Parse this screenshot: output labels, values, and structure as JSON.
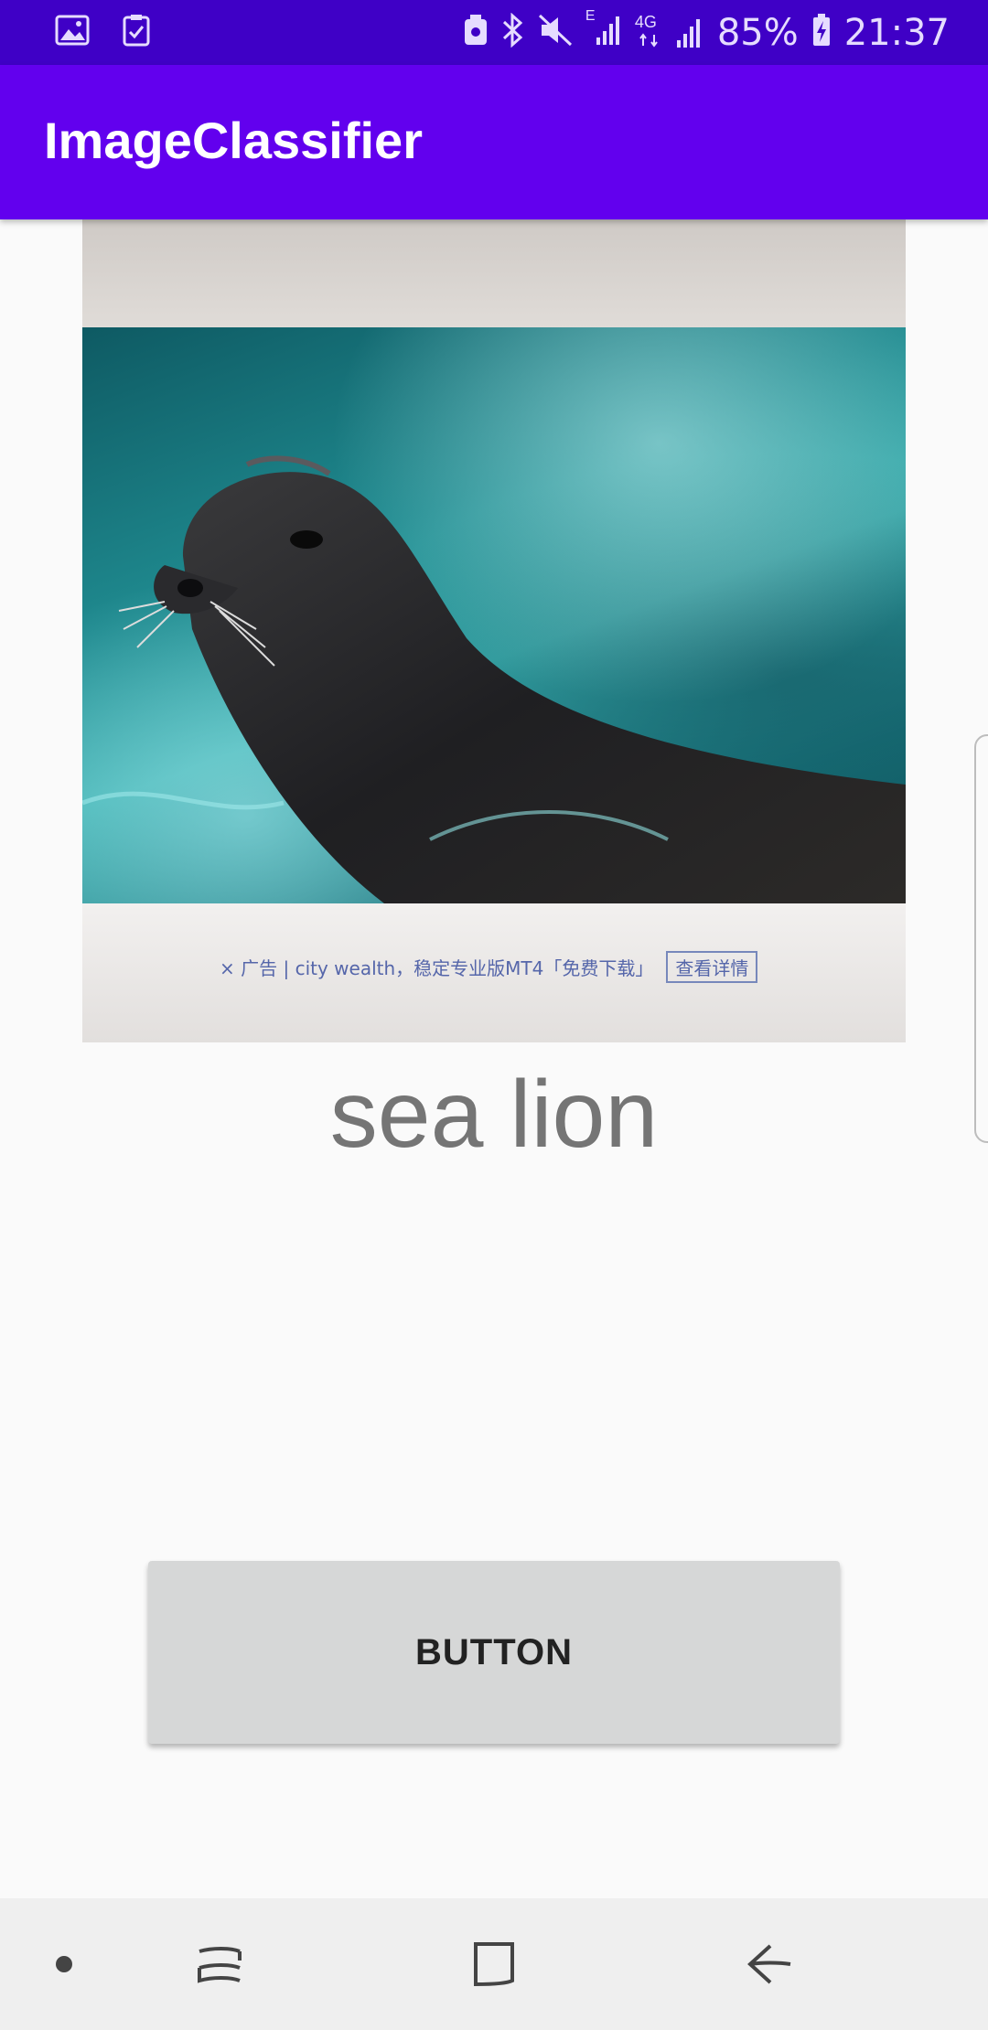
{
  "status_bar": {
    "battery_percent": "85%",
    "time": "21:37",
    "network_labels": [
      "E",
      "4G"
    ],
    "icons": [
      "gallery-icon",
      "task-check-icon",
      "android-device-icon",
      "bluetooth-icon",
      "mute-icon",
      "signal-e-icon",
      "signal-4g-icon",
      "battery-charging-icon"
    ]
  },
  "app_bar": {
    "title": "ImageClassifier",
    "color": "#6200ee",
    "status_color": "#3f00c6"
  },
  "image": {
    "ad_text": "×  广告 | city wealth，稳定专业版MT4「免费下载」",
    "ad_button": "查看详情"
  },
  "result": {
    "label": "sea lion"
  },
  "main_button": {
    "label": "BUTTON"
  },
  "nav_bar": {
    "icons": [
      "dot-icon",
      "recents-icon",
      "home-icon",
      "back-icon"
    ]
  }
}
